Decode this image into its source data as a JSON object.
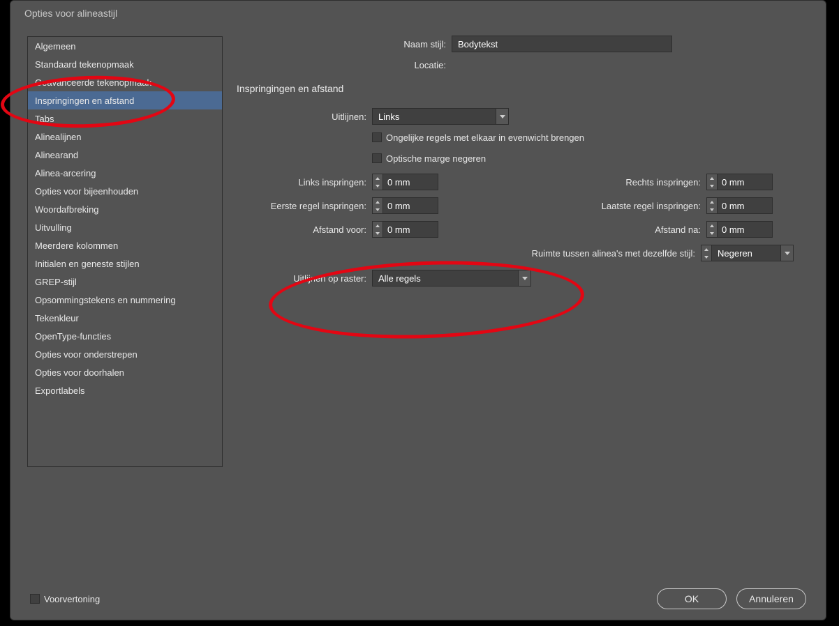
{
  "dialog_title": "Opties voor alineastijl",
  "sidebar": {
    "items": [
      {
        "label": "Algemeen",
        "selected": false
      },
      {
        "label": "Standaard tekenopmaak",
        "selected": false
      },
      {
        "label": "Geavanceerde tekenopmaak",
        "selected": false
      },
      {
        "label": "Inspringingen en afstand",
        "selected": true
      },
      {
        "label": "Tabs",
        "selected": false
      },
      {
        "label": "Alinealijnen",
        "selected": false
      },
      {
        "label": "Alinearand",
        "selected": false
      },
      {
        "label": "Alinea-arcering",
        "selected": false
      },
      {
        "label": "Opties voor bijeenhouden",
        "selected": false
      },
      {
        "label": "Woordafbreking",
        "selected": false
      },
      {
        "label": "Uitvulling",
        "selected": false
      },
      {
        "label": "Meerdere kolommen",
        "selected": false
      },
      {
        "label": "Initialen en geneste stijlen",
        "selected": false
      },
      {
        "label": "GREP-stijl",
        "selected": false
      },
      {
        "label": "Opsommingstekens en nummering",
        "selected": false
      },
      {
        "label": "Tekenkleur",
        "selected": false
      },
      {
        "label": "OpenType-functies",
        "selected": false
      },
      {
        "label": "Opties voor onderstrepen",
        "selected": false
      },
      {
        "label": "Opties voor doorhalen",
        "selected": false
      },
      {
        "label": "Exportlabels",
        "selected": false
      }
    ]
  },
  "header": {
    "naam_stijl_label": "Naam stijl:",
    "naam_stijl_value": "Bodytekst",
    "locatie_label": "Locatie:"
  },
  "section_title": "Inspringingen en afstand",
  "fields": {
    "uitlijnen_label": "Uitlijnen:",
    "uitlijnen_value": "Links",
    "ongelijke_label": "Ongelijke regels met elkaar in evenwicht brengen",
    "optische_label": "Optische marge negeren",
    "links_inspringen_label": "Links inspringen:",
    "links_inspringen_value": "0 mm",
    "rechts_inspringen_label": "Rechts inspringen:",
    "rechts_inspringen_value": "0 mm",
    "eerste_regel_label": "Eerste regel inspringen:",
    "eerste_regel_value": "0 mm",
    "laatste_regel_label": "Laatste regel inspringen:",
    "laatste_regel_value": "0 mm",
    "afstand_voor_label": "Afstand voor:",
    "afstand_voor_value": "0 mm",
    "afstand_na_label": "Afstand na:",
    "afstand_na_value": "0 mm",
    "ruimte_label": "Ruimte tussen alinea's met dezelfde stijl:",
    "ruimte_value": "Negeren",
    "raster_label": "Uitlijnen op raster:",
    "raster_value": "Alle regels"
  },
  "footer": {
    "voorvertoning_label": "Voorvertoning",
    "ok_label": "OK",
    "annuleren_label": "Annuleren"
  }
}
